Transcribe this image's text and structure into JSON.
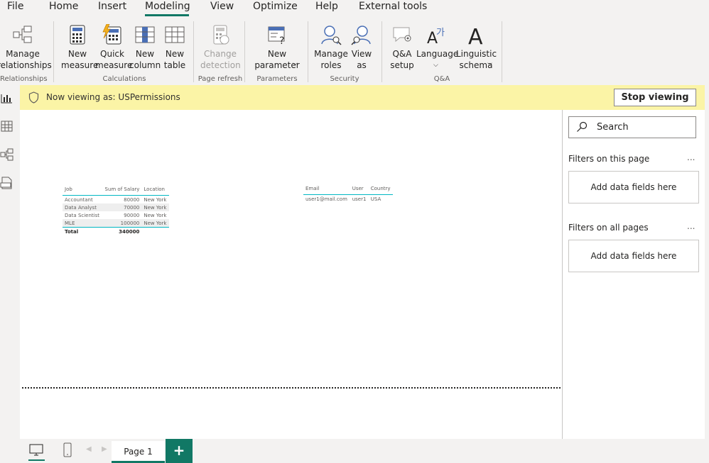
{
  "menu": {
    "items": [
      "File",
      "Home",
      "Insert",
      "Modeling",
      "View",
      "Optimize",
      "Help",
      "External tools"
    ],
    "active": "Modeling"
  },
  "ribbon": {
    "relationships": {
      "manage": "Manage\nrelationships",
      "group": "Relationships"
    },
    "calculations": {
      "new_measure": "New\nmeasure",
      "quick_measure": "Quick\nmeasure",
      "new_column": "New\ncolumn",
      "new_table": "New\ntable",
      "group": "Calculations"
    },
    "page_refresh": {
      "change_detection": "Change\ndetection",
      "group": "Page refresh"
    },
    "parameters": {
      "new_parameter": "New\nparameter",
      "group": "Parameters"
    },
    "security": {
      "manage_roles": "Manage\nroles",
      "view_as": "View\nas",
      "group": "Security"
    },
    "qa": {
      "qa_setup": "Q&A\nsetup",
      "language": "Language",
      "linguistic_schema": "Linguistic\nschema",
      "group": "Q&A"
    }
  },
  "banner": {
    "text": "Now viewing as: USPermissions",
    "stop_label": "Stop viewing",
    "color": "#fbf4a6"
  },
  "salary_table": {
    "headers": [
      "Job",
      "Sum of Salary",
      "Location"
    ],
    "rows": [
      [
        "Accountant",
        "80000",
        "New York"
      ],
      [
        "Data Analyst",
        "70000",
        "New York"
      ],
      [
        "Data Scientist",
        "90000",
        "New York"
      ],
      [
        "MLE",
        "100000",
        "New York"
      ]
    ],
    "total": [
      "Total",
      "340000",
      ""
    ]
  },
  "user_table": {
    "headers": [
      "Email",
      "User",
      "Country"
    ],
    "rows": [
      [
        "user1@mail.com",
        "user1",
        "USA"
      ]
    ]
  },
  "filters": {
    "search_placeholder": "Search",
    "this_page_title": "Filters on this page",
    "all_pages_title": "Filters on all pages",
    "more": "...",
    "dropzone_label": "Add data fields here"
  },
  "pages": {
    "tabs": [
      "Page 1"
    ],
    "add_label": "+"
  },
  "colors": {
    "accent": "#117865",
    "table_rule": "#00b7c3"
  }
}
